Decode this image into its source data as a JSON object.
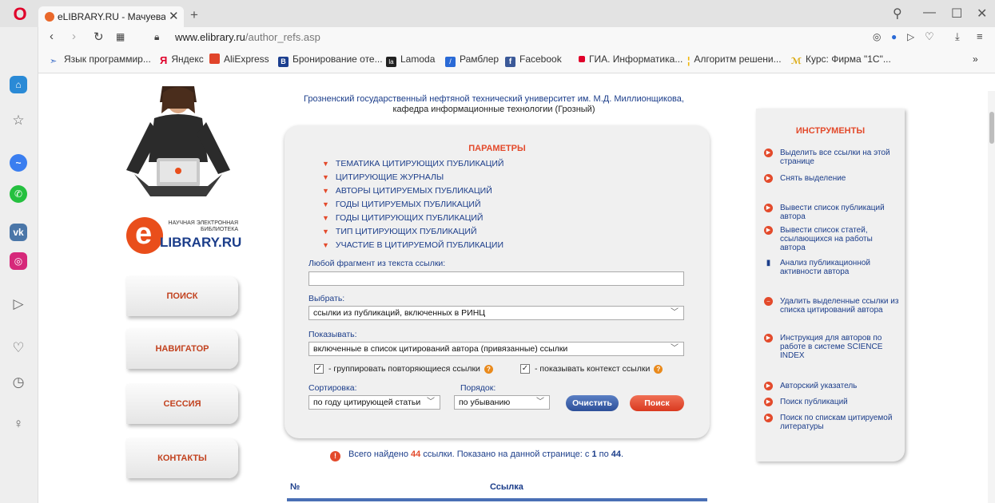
{
  "browser": {
    "tab_title": "eLIBRARY.RU - Мачуева Д...",
    "url_host": "www.elibrary.ru",
    "url_path": "/author_refs.asp",
    "bookmarks": [
      {
        "label": "Язык программир...",
        "color": "#3b6ec9"
      },
      {
        "label": "Яндекс",
        "color": "#e0002a"
      },
      {
        "label": "AliExpress",
        "color": "#e0442a"
      },
      {
        "label": "Бронирование оте...",
        "color": "#1c3f8f"
      },
      {
        "label": "Lamoda",
        "color": "#222222"
      },
      {
        "label": "Рамблер",
        "color": "#2a6ad6"
      },
      {
        "label": "Facebook",
        "color": "#3b5998"
      },
      {
        "label": "ГИА. Информатика...",
        "color": "#e0002a"
      },
      {
        "label": "Алгоритм решени...",
        "color": "#f0b400"
      },
      {
        "label": "Курс: Фирма \"1С\"...",
        "color": "#d9a400"
      }
    ],
    "bookmarks_more": "»"
  },
  "header": {
    "university": "Грозненский государственный нефтяной технический университет им. М.Д. Миллионщикова,",
    "department": "кафедра информационные технологии (Грозный)"
  },
  "logo": {
    "top_line1": "НАУЧНАЯ ЭЛЕКТРОННАЯ",
    "top_line2": "БИБЛИОТЕКА",
    "name": "LIBRARY.RU",
    "letter": "e"
  },
  "left_nav": [
    "ПОИСК",
    "НАВИГАТОР",
    "СЕССИЯ",
    "КОНТАКТЫ"
  ],
  "params": {
    "title": "ПАРАМЕТРЫ",
    "items": [
      "ТЕМАТИКА ЦИТИРУЮЩИХ ПУБЛИКАЦИЙ",
      "ЦИТИРУЮЩИЕ ЖУРНАЛЫ",
      "АВТОРЫ ЦИТИРУЕМЫХ ПУБЛИКАЦИЙ",
      "ГОДЫ ЦИТИРУЕМЫХ ПУБЛИКАЦИЙ",
      "ГОДЫ ЦИТИРУЮЩИХ ПУБЛИКАЦИЙ",
      "ТИП ЦИТИРУЮЩИХ ПУБЛИКАЦИЙ",
      "УЧАСТИЕ В ЦИТИРУЕМОЙ ПУБЛИКАЦИИ"
    ],
    "fragment_label": "Любой фрагмент из текста ссылки:",
    "fragment_value": "",
    "select_label": "Выбрать:",
    "select_value": "ссылки из публикаций, включенных в РИНЦ",
    "show_label": "Показывать:",
    "show_value": "включенные в список цитирований автора (привязанные) ссылки",
    "group_label": "- группировать повторяющиеся ссылки",
    "context_label": "- показывать контекст ссылки",
    "sort_label": "Сортировка:",
    "sort_value": "по году цитирующей статьи",
    "order_label": "Порядок:",
    "order_value": "по убыванию",
    "clear_button": "Очистить",
    "search_button": "Поиск"
  },
  "tools": {
    "title": "ИНСТРУМЕНТЫ",
    "items": [
      "Выделить все ссылки на этой странице",
      "Снять выделение",
      "Вывести список публикаций автора",
      "Вывести список статей, ссылающихся на работы автора",
      "Анализ публикационной активности автора",
      "Удалить выделенные ссылки из списка цитирований автора",
      "Инструкция для авторов по работе в системе SCIENCE INDEX",
      "Авторский указатель",
      "Поиск публикаций",
      "Поиск по спискам цитируемой литературы"
    ]
  },
  "results": {
    "prefix": "Всего найдено",
    "count": "44",
    "middle": "ссылки. Показано на данной странице: с",
    "from": "1",
    "to_word": "по",
    "to": "44",
    "col_num": "№",
    "col_link": "Ссылка"
  }
}
